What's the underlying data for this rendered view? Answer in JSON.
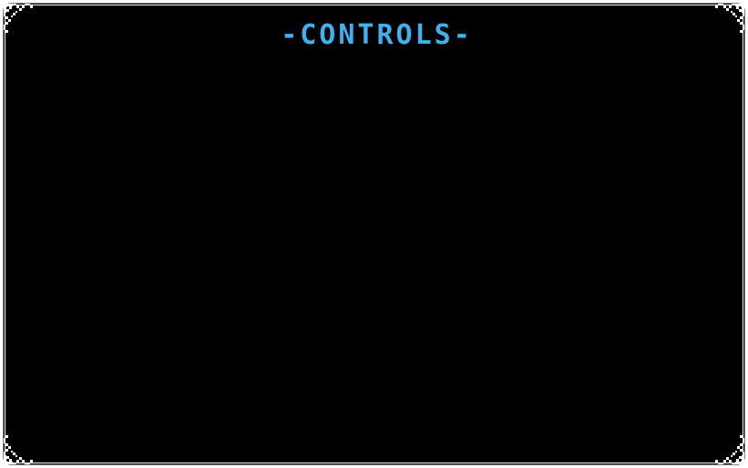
{
  "menu": {
    "title": "-CONTROLS-"
  },
  "colors": {
    "title": "#3fb0f0",
    "panel_background": "#000000",
    "border": "#ffffff"
  },
  "icons": {
    "corner": "ornate-corner-icon"
  }
}
